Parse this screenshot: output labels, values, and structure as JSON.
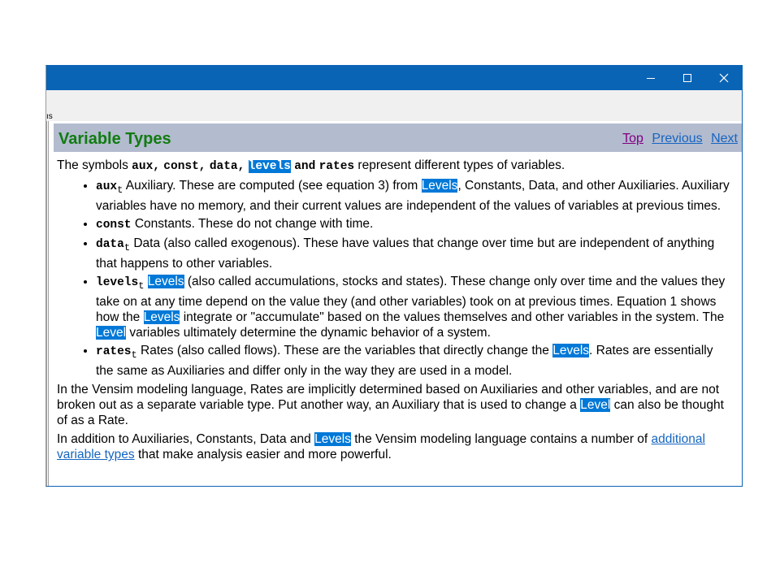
{
  "window": {
    "controls": {
      "minimize": "minimize-icon",
      "maximize": "maximize-icon",
      "close": "close-icon"
    },
    "toolbar_fragment": "ıs"
  },
  "topic": {
    "title": "Variable Types",
    "nav": {
      "top": "Top",
      "previous": "Previous",
      "next": "Next"
    }
  },
  "intro": {
    "t1": "The symbols ",
    "aux": "aux,",
    "const": "const,",
    "data": "data,",
    "levels": "levels",
    "and": "and",
    "rates": "rates",
    "t2": " represent different types of variables."
  },
  "items": [
    {
      "sym": "aux",
      "sub": "t",
      "t1": " Auxiliary.  These are computed (see equation 3) from ",
      "hl": "Levels",
      "t2": ", Constants, Data, and other Auxiliaries.  Auxiliary variables have no memory, and their current values are independent of the values of variables at previous times."
    },
    {
      "sym": "const",
      "sub": "",
      "t1": " Constants.  These do not change with time.",
      "hl": "",
      "t2": ""
    },
    {
      "sym": "data",
      "sub": "t",
      "t1": " Data (also called exogenous).  These have values that change over time but are independent of anything that happens to other variables.",
      "hl": "",
      "t2": ""
    },
    {
      "sym": "levels",
      "sub": "t",
      "hl0": "Levels",
      "t1": " (also called accumulations, stocks and states).  These change only over time and the values they take on at any time depend on the value they (and other variables) took on at previous times.  Equation 1 shows how the ",
      "hl": "Levels",
      "t2": " integrate or \"accumulate\" based on the values themselves and other variables in the system.  The ",
      "hl2": "Level",
      "t3": " variables ultimately determine the dynamic behavior of a system."
    },
    {
      "sym": "rates",
      "sub": "t",
      "t1": " Rates (also called flows).  These are the variables that directly change the ",
      "hl": "Levels",
      "t2": ".  Rates are essentially the same as Auxiliaries and differ only in the way they are used in a model."
    }
  ],
  "para2": {
    "t1": "In the Vensim modeling language, Rates are implicitly determined based on Auxiliaries and other variables, and are not broken out as a separate variable type.  Put another way, an Auxiliary that is used to change a ",
    "hl": "Level",
    "t2": " can also be thought of as a Rate."
  },
  "para3": {
    "t1": "In addition to Auxiliaries, Constants, Data and ",
    "hl": "Levels",
    "t2": " the Vensim modeling language contains a number of ",
    "link": "additional variable types",
    "t3": " that make analysis easier and more powerful."
  },
  "colors": {
    "titlebar": "#0a64b5",
    "topic_bar": "#b3bbcf",
    "title_green": "#107c10",
    "highlight": "#0078d7",
    "link": "#1565c0",
    "visited": "#800080"
  }
}
